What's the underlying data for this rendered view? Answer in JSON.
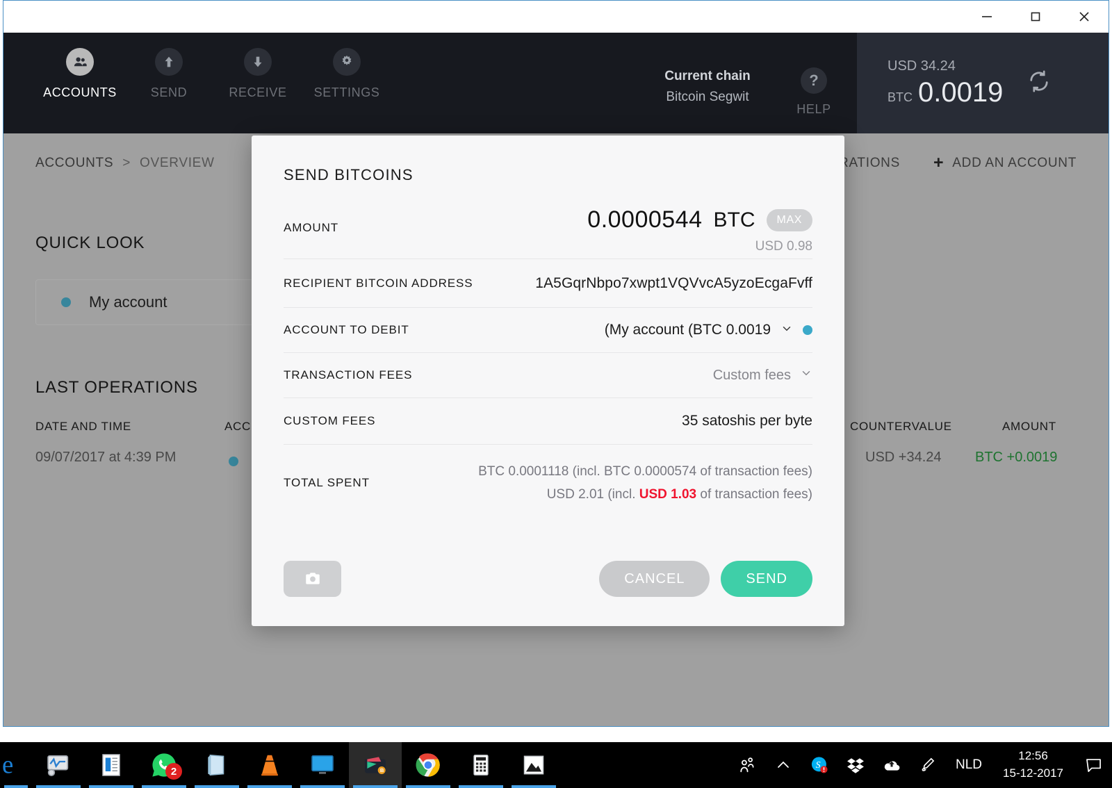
{
  "window": {
    "controls": [
      {
        "name": "minimize",
        "glyph": "minimize-icon"
      },
      {
        "name": "maximize",
        "glyph": "maximize-icon"
      },
      {
        "name": "close",
        "glyph": "close-icon"
      }
    ]
  },
  "header": {
    "nav": [
      {
        "label": "ACCOUNTS",
        "icon": "people-icon",
        "active": true
      },
      {
        "label": "SEND",
        "icon": "arrow-up-icon",
        "active": false
      },
      {
        "label": "RECEIVE",
        "icon": "arrow-down-icon",
        "active": false
      },
      {
        "label": "SETTINGS",
        "icon": "gear-icon",
        "active": false
      }
    ],
    "chain": {
      "title": "Current chain",
      "value": "Bitcoin Segwit"
    },
    "help": {
      "label": "HELP",
      "icon": "question-mark-icon"
    },
    "balance": {
      "fiat": "USD 34.24",
      "unit": "BTC",
      "amount": "0.0019",
      "refresh_icon": "sync-icon"
    },
    "active_indicator_color": "#b0213f"
  },
  "breadcrumb": {
    "root": "ACCOUNTS",
    "separator": ">",
    "current": "OVERVIEW",
    "actions": [
      {
        "label": "PERATIONS",
        "icon": null
      },
      {
        "label": "ADD AN ACCOUNT",
        "icon": "plus-icon"
      }
    ]
  },
  "quick_look": {
    "title": "QUICK LOOK",
    "account": {
      "name": "My account",
      "status_color": "#3b8ea5"
    }
  },
  "last_operations": {
    "title": "LAST OPERATIONS",
    "columns": [
      "DATE AND TIME",
      "ACC",
      "COUNTERVALUE",
      "AMOUNT"
    ],
    "rows": [
      {
        "date": "09/07/2017 at 4:39 PM",
        "account_dot_color": "#3b8ea5",
        "countervalue": "USD +34.24",
        "amount": "BTC +0.0019",
        "amount_color": "#1f7a32"
      }
    ]
  },
  "modal": {
    "title": "SEND BITCOINS",
    "amount": {
      "label": "AMOUNT",
      "value": "0.0000544",
      "unit": "BTC",
      "max_label": "MAX",
      "countervalue": "USD 0.98"
    },
    "recipient": {
      "label": "RECIPIENT BITCOIN ADDRESS",
      "value": "1A5GqrNbpo7xwpt1VQVvcA5yzoEcgaFvff"
    },
    "account_to_debit": {
      "label": "ACCOUNT TO DEBIT",
      "value": "(My account (BTC 0.0019",
      "chevron": "chevron-down-icon",
      "status_color": "#3ba9c9"
    },
    "transaction_fees": {
      "label": "TRANSACTION FEES",
      "value": "Custom fees",
      "chevron": "chevron-down-icon"
    },
    "custom_fees": {
      "label": "CUSTOM FEES",
      "value": "35 satoshis per byte"
    },
    "total_spent": {
      "label": "TOTAL SPENT",
      "btc_prefix": "BTC 0.0001118 (incl. BTC 0.0000574 of transaction fees)",
      "usd_pre": "USD 2.01 (incl. ",
      "usd_highlight": "USD 1.03",
      "usd_post": " of transaction fees)",
      "highlight_color": "#f0142f"
    },
    "footer": {
      "qr_icon": "camera-icon",
      "cancel_label": "CANCEL",
      "send_label": "SEND",
      "send_color": "#3fcfa8"
    }
  },
  "taskbar": {
    "apps": [
      {
        "name": "edge-icon",
        "open": false
      },
      {
        "name": "system-monitor-icon",
        "open": false
      },
      {
        "name": "reader-icon",
        "open": false
      },
      {
        "name": "whatsapp-icon",
        "open": false,
        "badge": "2"
      },
      {
        "name": "notepad-icon",
        "open": false
      },
      {
        "name": "vlc-icon",
        "open": false
      },
      {
        "name": "remote-desktop-icon",
        "open": false
      },
      {
        "name": "ledger-wallet-icon",
        "open": true
      },
      {
        "name": "chrome-icon",
        "open": false
      },
      {
        "name": "calculator-icon",
        "open": false
      },
      {
        "name": "photos-icon",
        "open": false
      }
    ],
    "tray": [
      {
        "name": "people-icon"
      },
      {
        "name": "show-hidden-icons-icon"
      },
      {
        "name": "skype-icon"
      },
      {
        "name": "dropbox-icon"
      },
      {
        "name": "onedrive-icon"
      },
      {
        "name": "pen-icon"
      }
    ],
    "language": "NLD",
    "clock": {
      "time": "12:56",
      "date": "15-12-2017"
    },
    "action_center": "notifications-icon"
  }
}
